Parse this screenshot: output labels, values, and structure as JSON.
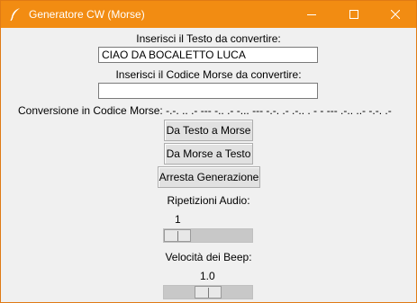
{
  "window": {
    "title": "Generatore CW (Morse)",
    "title_color": "#ffffff",
    "titlebar_color": "#f28c12",
    "app_icon": "feather-icon",
    "controls": [
      "minimize-icon",
      "maximize-icon",
      "close-icon"
    ]
  },
  "text_input": {
    "label": "Inserisci il Testo da convertire:",
    "value": "CIAO DA BOCALETTO LUCA"
  },
  "morse_input": {
    "label": "Inserisci il Codice Morse da convertire:",
    "value": ""
  },
  "conversion": {
    "label": "Conversione in Codice Morse:",
    "value": "-.-. .. .- --- -.. .- -... --- -.-. .- .-.. . - - --- .-.. ..- -.-. .-"
  },
  "buttons": {
    "text_to_morse": "Da Testo a Morse",
    "morse_to_text": "Da Morse a Testo",
    "stop": "Arresta Generazione"
  },
  "repetitions": {
    "label": "Ripetizioni Audio:",
    "value": "1",
    "level": 0.0
  },
  "speed": {
    "label": "Velocità dei Beep:",
    "value": "1.0",
    "level": 0.5
  }
}
